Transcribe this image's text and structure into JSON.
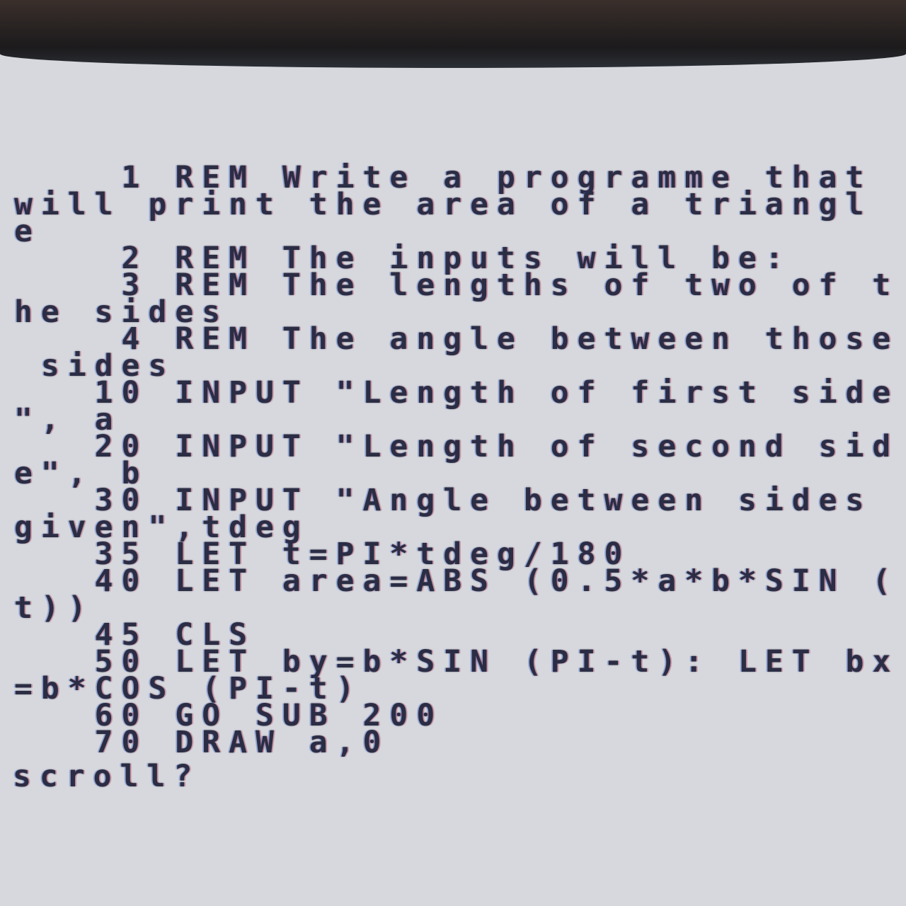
{
  "listing": {
    "lines": [
      "    1 REM Write a programme that",
      "will print the area of a triangl",
      "e",
      "    2 REM The inputs will be:",
      "    3 REM The lengths of two of t",
      "he sides",
      "    4 REM The angle between those",
      " sides",
      "   10 INPUT \"Length of first side",
      "\", a",
      "   20 INPUT \"Length of second sid",
      "e\", b",
      "   30 INPUT \"Angle between sides ",
      "given\",tdeg",
      "   35 LET t=PI*tdeg/180",
      "   40 LET area=ABS (0.5*a*b*SIN (",
      "t))",
      "   45 CLS",
      "   50 LET by=b*SIN (PI-t): LET bx",
      "=b*COS (PI-t)",
      "   60 GO SUB 200",
      "   70 DRAW a,0"
    ]
  },
  "prompt": {
    "text": "scroll?"
  }
}
